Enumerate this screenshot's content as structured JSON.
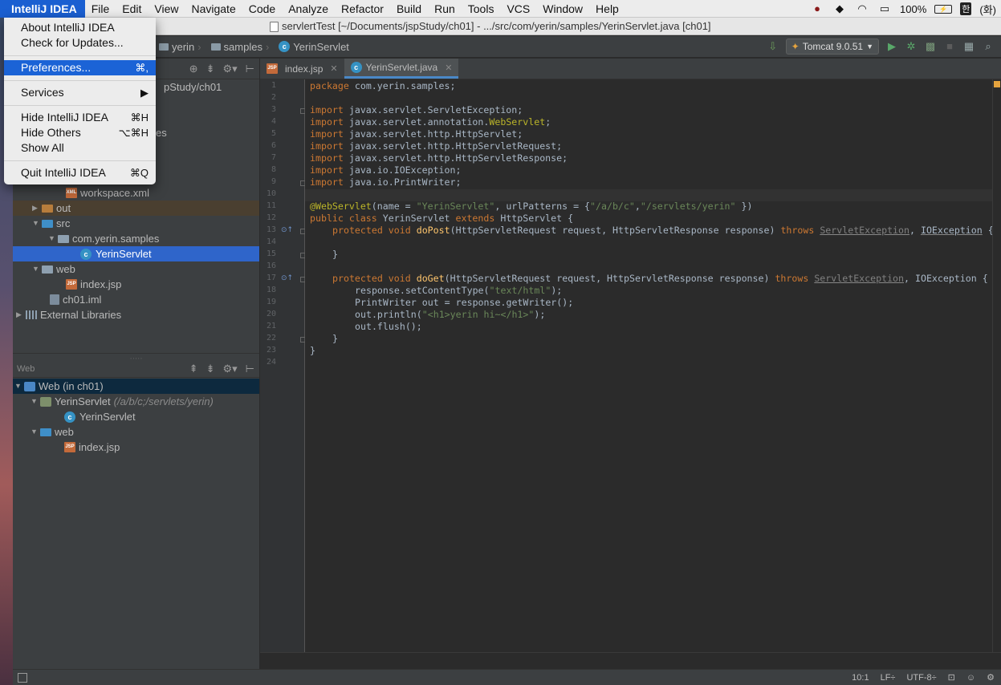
{
  "menubar": {
    "app_name": "IntelliJ IDEA",
    "items": [
      "File",
      "Edit",
      "View",
      "Navigate",
      "Code",
      "Analyze",
      "Refactor",
      "Build",
      "Run",
      "Tools",
      "VCS",
      "Window",
      "Help"
    ],
    "battery": "100%",
    "input_method": "한",
    "day": "(화)"
  },
  "window": {
    "title": "servlertTest [~/Documents/jspStudy/ch01] - .../src/com/yerin/samples/YerinServlet.java [ch01]"
  },
  "navbar": {
    "crumbs": [
      "yerin",
      "samples",
      "YerinServlet"
    ],
    "run_config": "Tomcat 9.0.51"
  },
  "app_menu": {
    "about": "About IntelliJ IDEA",
    "check_updates": "Check for Updates...",
    "preferences": "Preferences...",
    "preferences_shortcut": "⌘,",
    "services": "Services",
    "hide": "Hide IntelliJ IDEA",
    "hide_shortcut": "⌘H",
    "hide_others": "Hide Others",
    "hide_others_shortcut": "⌥⌘H",
    "show_all": "Show All",
    "quit": "Quit IntelliJ IDEA",
    "quit_shortcut": "⌘Q"
  },
  "project": {
    "root_path_fragment": "pStudy/ch01",
    "partial_label": "es",
    "tree": {
      "workspace": "workspace.xml",
      "out": "out",
      "src": "src",
      "package": "com.yerin.samples",
      "servlet": "YerinServlet",
      "web": "web",
      "index": "index.jsp",
      "iml": "ch01.iml",
      "libs": "External Libraries"
    }
  },
  "web_panel": {
    "header": "Web",
    "root": "Web (in ch01)",
    "servlet_mapping": "YerinServlet",
    "servlet_mapping_hint": "(/a/b/c;/servlets/yerin)",
    "servlet_class": "YerinServlet",
    "web_folder": "web",
    "index": "index.jsp"
  },
  "editor": {
    "tabs": [
      "index.jsp",
      "YerinServlet.java"
    ],
    "line_numbers": [
      "1",
      "2",
      "3",
      "4",
      "5",
      "6",
      "7",
      "8",
      "9",
      "10",
      "11",
      "12",
      "13",
      "14",
      "15",
      "16",
      "17",
      "18",
      "19",
      "20",
      "21",
      "22",
      "23",
      "24"
    ],
    "code": {
      "l1_kw": "package",
      "l1_rest": " com.yerin.samples;",
      "import_kw": "import",
      "l3": " javax.servlet.ServletException;",
      "l4a": " javax.servlet.annotation.",
      "l4b": "WebServlet",
      "l4c": ";",
      "l5": " javax.servlet.http.HttpServlet;",
      "l6": " javax.servlet.http.HttpServletRequest;",
      "l7": " javax.servlet.http.HttpServletResponse;",
      "l8": " java.io.IOException;",
      "l9": " java.io.PrintWriter;",
      "l11_ann": "@WebServlet",
      "l11_a": "(name = ",
      "l11_str1": "\"YerinServlet\"",
      "l11_b": ", urlPatterns = {",
      "l11_str2": "\"/a/b/c\"",
      "l11_c": ",",
      "l11_str3": "\"/servlets/yerin\"",
      "l11_d": " })",
      "l12_kw": "public class",
      "l12_name": " YerinServlet",
      "l12_kw2": " extends",
      "l12_rest": " HttpServlet {",
      "l13_kw": "protected void",
      "l13_fn": " doPost",
      "l13_a": "(HttpServletRequest request, HttpServletResponse response) ",
      "l13_kw2": "throws",
      "l13_ex1": "ServletException",
      "l13_ex2": "IOException",
      "l13_end": " {",
      "l15": "}",
      "l17_fn": " doGet",
      "l17_a": "(HttpServletRequest request, HttpServletResponse response) ",
      "l17_ex1": "ServletException",
      "l17_ex2": "IOException",
      "l17_end": " {",
      "l18a": "response.setContentType(",
      "l18_str": "\"text/html\"",
      "l18b": ");",
      "l19": "PrintWriter out = response.getWriter();",
      "l20a": "out.println(",
      "l20_str": "\"<h1>yerin hi~</h1>\"",
      "l20b": ");",
      "l21": "out.flush();",
      "l22": "}",
      "l23": "}"
    }
  },
  "statusbar": {
    "position": "10:1",
    "line_sep": "LF÷",
    "encoding": "UTF-8÷"
  }
}
